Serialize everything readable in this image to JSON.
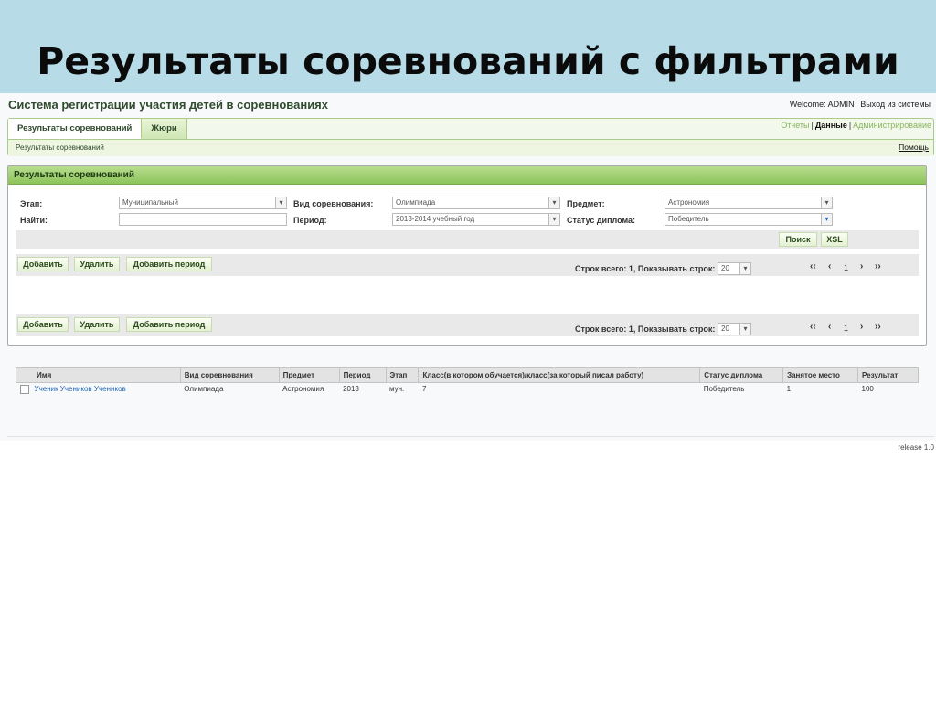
{
  "slide_title": "Результаты соревнований с фильтрами",
  "app": {
    "title": "Система регистрации участия детей в соревнованиях",
    "welcome": "Welcome: ADMIN",
    "logout": "Выход из системы"
  },
  "tabs": [
    "Результаты соревнований",
    "Жюри"
  ],
  "top_links": {
    "reports": "Отчеты",
    "data": "Данные",
    "admin": "Администрирование",
    "separator": "|"
  },
  "breadcrumb": "Результаты соревнований",
  "help": "Помощь",
  "panel": {
    "title": "Результаты соревнований"
  },
  "filters": {
    "stage_label": "Этап:",
    "stage_value": "Муниципальный",
    "search_label": "Найти:",
    "search_value": "",
    "kind_label": "Вид соревнования:",
    "kind_value": "Олимпиада",
    "period_label": "Период:",
    "period_value": "2013-2014 учебный год",
    "subject_label": "Предмет:",
    "subject_value": "Астрономия",
    "status_label": "Статус диплома:",
    "status_value": "Победитель"
  },
  "buttons": {
    "search": "Поиск",
    "xsl": "XSL",
    "add": "Добавить",
    "delete": "Удалить",
    "add_period": "Добавить период"
  },
  "paging": {
    "rows_info": "Строк всего: 1, Показывать строк:",
    "rows_per_page": "20",
    "first": "‹‹",
    "prev": "‹",
    "page": "1",
    "next": "›",
    "last": "››"
  },
  "table": {
    "columns": [
      "Имя",
      "Вид соревнования",
      "Предмет",
      "Период",
      "Этап",
      "Класс(в котором обучается)/класс(за который писал работу)",
      "Статус диплома",
      "Занятое место",
      "Результат"
    ],
    "rows": [
      {
        "name": "Ученик Учеников Учеников",
        "kind": "Олимпиада",
        "subject": "Астрономия",
        "period": "2013",
        "stage": "мун.",
        "class": "7",
        "status": "Победитель",
        "place": "1",
        "result": "100"
      }
    ]
  },
  "release": "release 1.0",
  "colors": {
    "slide_header": "#b7dbe7",
    "panel_header": "#8cc45b",
    "link": "#2468b8"
  },
  "icons": {
    "dropdown": "chevron-down-icon",
    "checkbox": "checkbox-icon"
  }
}
